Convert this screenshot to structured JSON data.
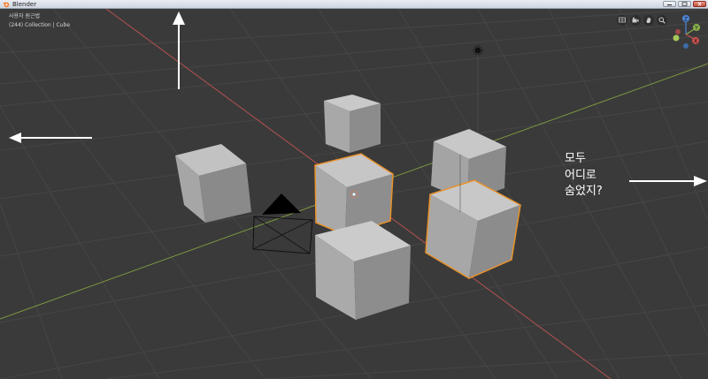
{
  "window": {
    "title": "Blender"
  },
  "viewport": {
    "mode_label": "사용자 원근법",
    "context_label": "(244) Collection | Cube"
  },
  "gizmo": {
    "z_label": "Z",
    "y_label": "Y",
    "x_label": "X"
  },
  "annotation": {
    "line1": "모두",
    "line2": "어디로",
    "line3": "숨었지?"
  },
  "colors": {
    "selection_outline": "#e8922a",
    "x_axis": "#c8504f",
    "y_axis": "#8ab04a",
    "viewport_bg": "#3a3a3a"
  },
  "icons": {
    "viewport_buttons": [
      "view-grid-icon",
      "camera-icon",
      "hand-icon",
      "zoom-icon"
    ]
  }
}
